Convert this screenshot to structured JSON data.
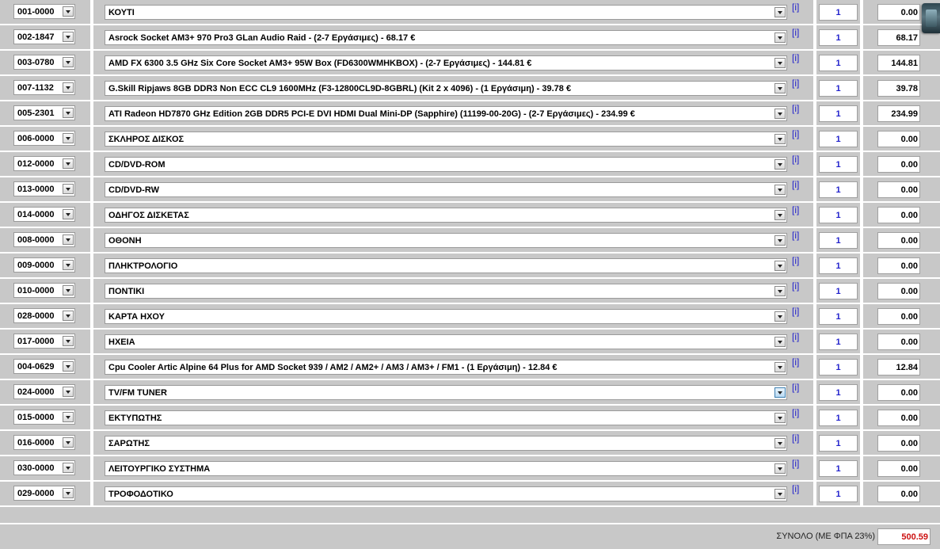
{
  "rows": [
    {
      "code": "001-0000",
      "product": "ΚΟΥΤΙ",
      "qty": "1",
      "price": "0.00"
    },
    {
      "code": "002-1847",
      "product": "Asrock Socket AM3+ 970 Pro3 GLan Audio Raid - (2-7 Εργάσιμες) - 68.17 €",
      "qty": "1",
      "price": "68.17"
    },
    {
      "code": "003-0780",
      "product": "AMD FX 6300 3.5 GHz Six Core Socket AM3+ 95W Box (FD6300WMHKBOX) - (2-7 Εργάσιμες) - 144.81 €",
      "qty": "1",
      "price": "144.81"
    },
    {
      "code": "007-1132",
      "product": "G.Skill Ripjaws 8GB DDR3 Non ECC CL9 1600MHz (F3-12800CL9D-8GBRL) (Kit 2 x 4096) - (1 Εργάσιμη) - 39.78 €",
      "qty": "1",
      "price": "39.78"
    },
    {
      "code": "005-2301",
      "product": "ATI Radeon HD7870 GHz Edition 2GB DDR5 PCI-E DVI HDMI Dual Mini-DP (Sapphire) (11199-00-20G) - (2-7 Εργάσιμες) - 234.99 €",
      "qty": "1",
      "price": "234.99"
    },
    {
      "code": "006-0000",
      "product": "ΣΚΛΗΡΟΣ ΔΙΣΚΟΣ",
      "qty": "1",
      "price": "0.00"
    },
    {
      "code": "012-0000",
      "product": "CD/DVD-ROM",
      "qty": "1",
      "price": "0.00"
    },
    {
      "code": "013-0000",
      "product": "CD/DVD-RW",
      "qty": "1",
      "price": "0.00"
    },
    {
      "code": "014-0000",
      "product": "ΟΔΗΓΟΣ ΔΙΣΚΕΤΑΣ",
      "qty": "1",
      "price": "0.00"
    },
    {
      "code": "008-0000",
      "product": "ΟΘΟΝΗ",
      "qty": "1",
      "price": "0.00"
    },
    {
      "code": "009-0000",
      "product": "ΠΛΗΚΤΡΟΛΟΓΙΟ",
      "qty": "1",
      "price": "0.00"
    },
    {
      "code": "010-0000",
      "product": "ΠΟΝΤΙΚΙ",
      "qty": "1",
      "price": "0.00"
    },
    {
      "code": "028-0000",
      "product": "ΚΑΡΤΑ ΗΧΟΥ",
      "qty": "1",
      "price": "0.00"
    },
    {
      "code": "017-0000",
      "product": "ΗΧΕΙΑ",
      "qty": "1",
      "price": "0.00"
    },
    {
      "code": "004-0629",
      "product": "Cpu Cooler Artic Alpine 64 Plus for AMD Socket 939 / AM2 / AM2+ / AM3 / AM3+ / FM1 - (1 Εργάσιμη) - 12.84 €",
      "qty": "1",
      "price": "12.84"
    },
    {
      "code": "024-0000",
      "product": "TV/FM TUNER",
      "qty": "1",
      "price": "0.00",
      "active": true
    },
    {
      "code": "015-0000",
      "product": "ΕΚΤΥΠΩΤΗΣ",
      "qty": "1",
      "price": "0.00"
    },
    {
      "code": "016-0000",
      "product": "ΣΑΡΩΤΗΣ",
      "qty": "1",
      "price": "0.00"
    },
    {
      "code": "030-0000",
      "product": "ΛΕΙΤΟΥΡΓΙΚΟ ΣΥΣΤΗΜΑ",
      "qty": "1",
      "price": "0.00"
    },
    {
      "code": "029-0000",
      "product": "ΤΡΟΦΟΔΟΤΙΚΟ",
      "qty": "1",
      "price": "0.00"
    }
  ],
  "info_label": "[i]",
  "total": {
    "label": "ΣΥΝΟΛΟ (ΜΕ ΦΠΑ 23%)",
    "value": "500.59"
  },
  "colors": {
    "row_bg": "#c8c8c8",
    "info_link": "#2222cc",
    "qty_text": "#2222cc",
    "total_value": "#cc1111"
  }
}
